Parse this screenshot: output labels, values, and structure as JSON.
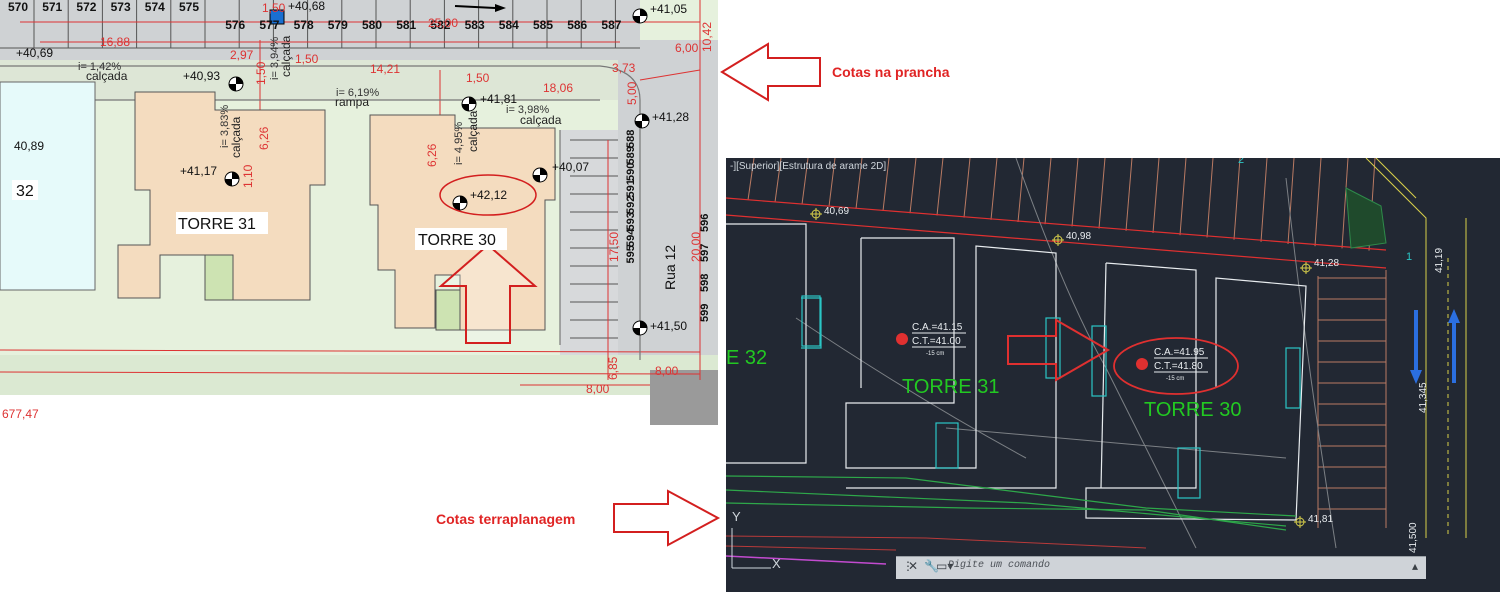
{
  "plan": {
    "top_lot_numbers": [
      "570",
      "571",
      "572",
      "573",
      "574",
      "575",
      "576",
      "577",
      "578",
      "579",
      "580",
      "581",
      "582",
      "583",
      "584",
      "585",
      "586",
      "587"
    ],
    "right_lot_numbers": [
      "588",
      "589",
      "590",
      "591",
      "592",
      "593",
      "594",
      "595",
      "596",
      "597",
      "598",
      "599"
    ],
    "dimensions": [
      "25,00",
      "16,88",
      "2,97",
      "1,50",
      "1,50",
      "14,21",
      "3,73",
      "6,00",
      "10,42",
      "18,06",
      "5,00",
      "1,50",
      "6,26",
      "6,26",
      "17,50",
      "20,00",
      "8,00",
      "8,00",
      "6,85",
      "1,10",
      "1,50"
    ],
    "slopes": [
      "i= 1,42%",
      "i= 3,94%",
      "i= 6,19%",
      "i= 3,98%",
      "i= 3,83%",
      "i= 4,95%"
    ],
    "labels": {
      "calcada": "calçada",
      "rampa": "rampa",
      "rua": "Rua 12",
      "torre31": "TORRE 31",
      "torre30": "TORRE 30",
      "torre32_part": "32"
    },
    "elevations": {
      "e1": "+40,68",
      "e2": "+41,05",
      "e3": "+40,69",
      "e4": "+40,93",
      "e5": "+41,81",
      "e6": "+41,28",
      "e7": "40,89",
      "e8": "+41,17",
      "e9": "+42,12",
      "e10": "+40,07",
      "e11": "+41,50",
      "e12": "677,47"
    }
  },
  "annotations": {
    "cotas_prancha": "Cotas na prancha",
    "cotas_terraplanagem": "Cotas terraplanagem"
  },
  "cad": {
    "viewport_title": "-][Superior][Estrutura de arame 2D]",
    "elevations": [
      "40,69",
      "40,98",
      "41,28",
      "41,81",
      "41,19",
      "41,345",
      "41,500"
    ],
    "torre32_label": "E 32",
    "torre31_label": "TORRE 31",
    "torre30_label": "TORRE 30",
    "torre31_ca": "C.A.=41.15",
    "torre31_ct": "C.T.=41.00",
    "torre31_offset": "-15 cm",
    "torre30_ca": "C.A.=41.95",
    "torre30_ct": "C.T.=41.80",
    "torre30_offset": "-15 cm",
    "ucs_y": "Y",
    "ucs_x": "X",
    "command_placeholder": "Digite um comando",
    "road_number": "1",
    "road_number2": "2",
    "colors": {
      "green_text": "#22c922",
      "red_line": "#e03030",
      "cyan": "#2bc6c6",
      "white": "#e8ecef"
    }
  }
}
